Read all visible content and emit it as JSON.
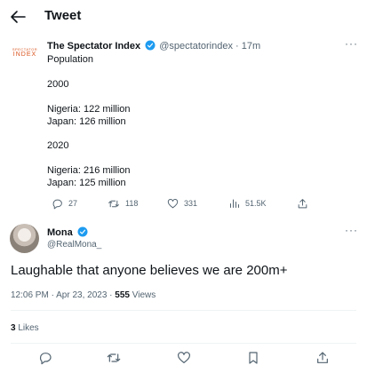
{
  "header": {
    "title": "Tweet"
  },
  "tweet1": {
    "logo_top": "SPECTATOR",
    "logo_main": "INDEX",
    "author_name": "The Spectator Index",
    "handle": "@spectatorindex",
    "separator": "·",
    "time": "17m",
    "lines": [
      "Population",
      "2000",
      "Nigeria: 122 million",
      "Japan: 126 million",
      "2020",
      "Nigeria: 216 million",
      "Japan: 125 million"
    ],
    "actions": {
      "replies": "27",
      "retweets": "118",
      "likes": "331",
      "views": "51.5K"
    }
  },
  "tweet2": {
    "author_name": "Mona",
    "handle": "@RealMona_",
    "text": "Laughable that anyone believes we are 200m+",
    "timestamp": "12:06 PM · Apr 23, 2023 · ",
    "views_count": "555",
    "views_label": " Views",
    "likes_count": "3",
    "likes_label": " Likes"
  },
  "colors": {
    "accent": "#1d9bf0",
    "muted": "#536471",
    "text": "#0f1419",
    "logo": "#d9531e"
  },
  "icons": [
    "back-arrow-icon",
    "verified-badge-icon",
    "more-icon",
    "reply-icon",
    "retweet-icon",
    "like-icon",
    "views-icon",
    "share-icon",
    "bookmark-icon"
  ]
}
